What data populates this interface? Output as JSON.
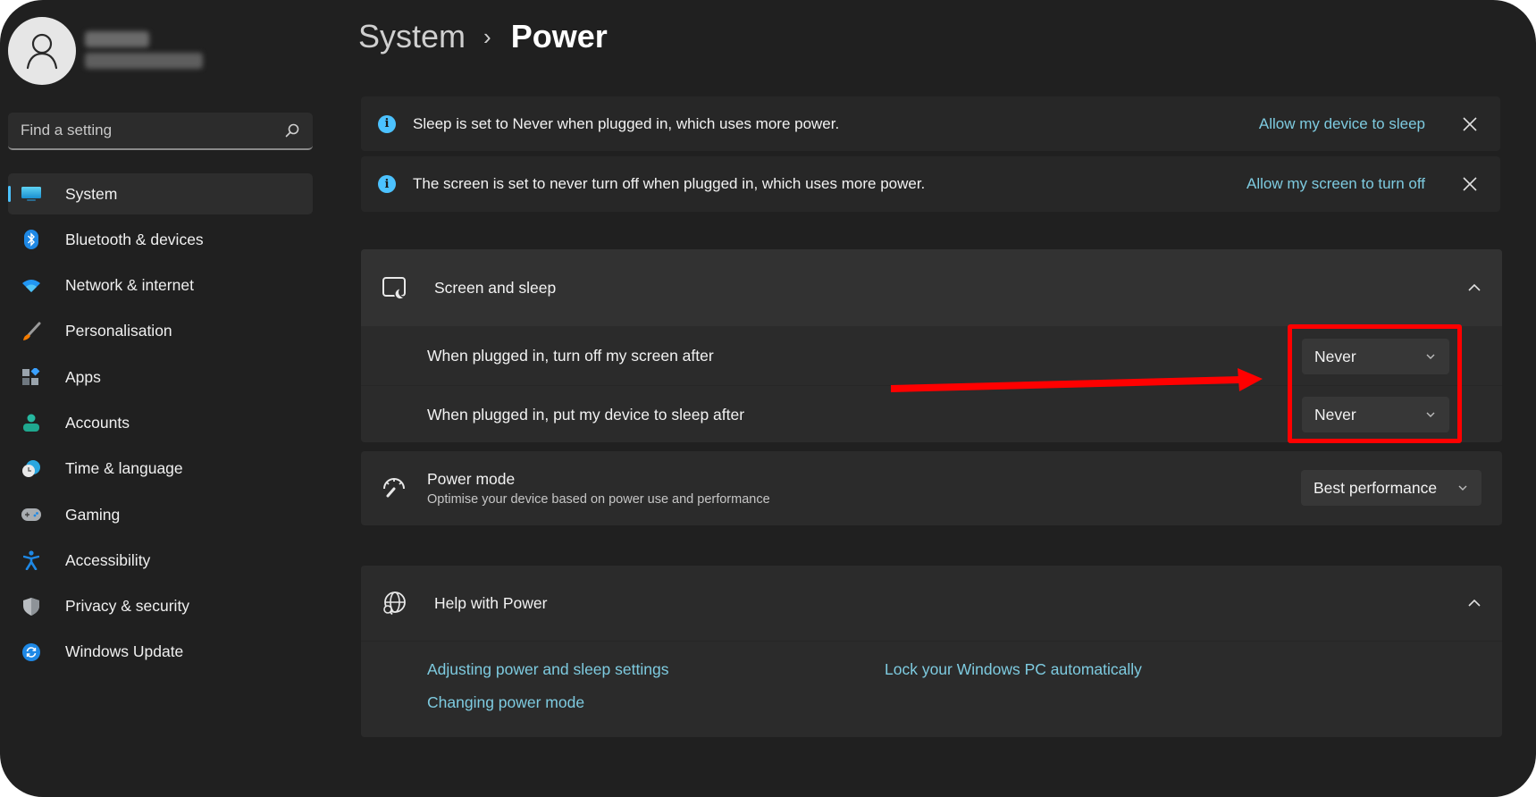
{
  "user": {
    "avatar_icon": "person-icon",
    "name_blurred": true
  },
  "search": {
    "placeholder": "Find a setting",
    "value": "",
    "icon": "search-icon"
  },
  "sidebar": {
    "items": [
      {
        "label": "System",
        "icon": "monitor-icon",
        "active": true
      },
      {
        "label": "Bluetooth & devices",
        "icon": "bluetooth-icon"
      },
      {
        "label": "Network & internet",
        "icon": "wifi-icon"
      },
      {
        "label": "Personalisation",
        "icon": "brush-icon"
      },
      {
        "label": "Apps",
        "icon": "apps-icon"
      },
      {
        "label": "Accounts",
        "icon": "account-icon"
      },
      {
        "label": "Time & language",
        "icon": "clock-globe-icon"
      },
      {
        "label": "Gaming",
        "icon": "gamepad-icon"
      },
      {
        "label": "Accessibility",
        "icon": "accessibility-icon"
      },
      {
        "label": "Privacy & security",
        "icon": "shield-icon"
      },
      {
        "label": "Windows Update",
        "icon": "update-icon"
      }
    ]
  },
  "header": {
    "parent": "System",
    "separator": "›",
    "current": "Power"
  },
  "info_bars": [
    {
      "text": "Sleep is set to Never when plugged in, which uses more power.",
      "link": "Allow my device to sleep"
    },
    {
      "text": "The screen is set to never turn off when plugged in, which uses more power.",
      "link": "Allow my screen to turn off"
    }
  ],
  "screen_sleep": {
    "title": "Screen and sleep",
    "expanded": true,
    "rows": [
      {
        "label": "When plugged in, turn off my screen after",
        "value": "Never"
      },
      {
        "label": "When plugged in, put my device to sleep after",
        "value": "Never"
      }
    ]
  },
  "power_mode": {
    "title": "Power mode",
    "subtitle": "Optimise your device based on power use and performance",
    "value": "Best performance"
  },
  "help": {
    "title": "Help with Power",
    "expanded": true,
    "links": [
      "Adjusting power and sleep settings",
      "Changing power mode",
      "Lock your Windows PC automatically"
    ]
  },
  "annotation": {
    "color": "#ff0000",
    "type": "arrow-and-box",
    "target": "screen-sleep-dropdowns"
  },
  "colors": {
    "accent": "#4cc2ff",
    "link": "#7ecbe0",
    "background": "#202020",
    "card": "#2b2b2b"
  }
}
